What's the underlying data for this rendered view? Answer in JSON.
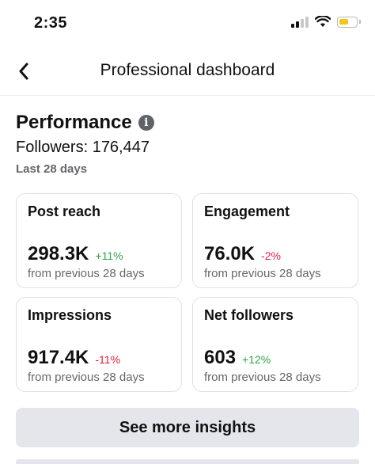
{
  "status_bar": {
    "time": "2:35",
    "signal_icon": "cellular-signal-icon",
    "wifi_icon": "wifi-icon",
    "battery_icon": "battery-low-icon",
    "battery_color": "#f5c518"
  },
  "header": {
    "back_icon": "chevron-left-icon",
    "title": "Professional dashboard"
  },
  "performance": {
    "title": "Performance",
    "info_icon": "info-icon",
    "followers": "Followers: 176,447",
    "period": "Last 28 days"
  },
  "metrics": [
    {
      "label": "Post reach",
      "value": "298.3K",
      "delta": "+11%",
      "trend": "up",
      "comparison": "from previous 28 days"
    },
    {
      "label": "Engagement",
      "value": "76.0K",
      "delta": "-2%",
      "trend": "down",
      "comparison": "from previous 28 days"
    },
    {
      "label": "Impressions",
      "value": "917.4K",
      "delta": "-11%",
      "trend": "down",
      "comparison": "from previous 28 days"
    },
    {
      "label": "Net followers",
      "value": "603",
      "delta": "+12%",
      "trend": "up",
      "comparison": "from previous 28 days"
    }
  ],
  "cta": {
    "label": "See more insights"
  },
  "colors": {
    "positive": "#31a24c",
    "negative": "#e41e3f",
    "button_bg": "#e4e6eb",
    "secondary_text": "#65676b"
  }
}
